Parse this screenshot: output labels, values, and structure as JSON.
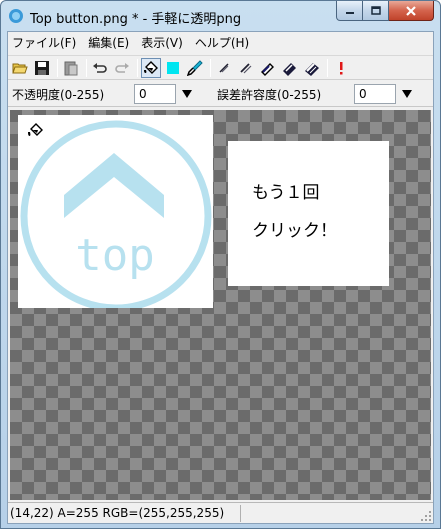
{
  "window": {
    "title": "Top button.png * - 手軽に透明png"
  },
  "menu": [
    {
      "label": "ファイル(F)"
    },
    {
      "label": "編集(E)"
    },
    {
      "label": "表示(V)"
    },
    {
      "label": "ヘルプ(H)"
    }
  ],
  "toolbar": {
    "icons": [
      "open-icon",
      "save-icon",
      "paste-icon",
      "undo-icon",
      "redo-icon",
      "fill-bucket-icon",
      "color-swatch-icon",
      "eyedropper-icon",
      "tolerance-1-icon",
      "tolerance-2-icon",
      "tolerance-3-icon",
      "tolerance-4-icon",
      "tolerance-5-icon",
      "alert-icon"
    ]
  },
  "options": {
    "opacity_label": "不透明度(0-255)",
    "opacity_value": "0",
    "tolerance_label": "誤差許容度(0-255)",
    "tolerance_value": "0"
  },
  "canvas": {
    "logo_text": "top",
    "note_line1": "もう１回",
    "note_line2": "クリック！",
    "colors": {
      "logo": "#b7e1ef",
      "checker_dark": "#6b6b6b",
      "checker_light": "#8d8d8d"
    }
  },
  "status": {
    "text": "(14,22) A=255 RGB=(255,255,255)"
  }
}
